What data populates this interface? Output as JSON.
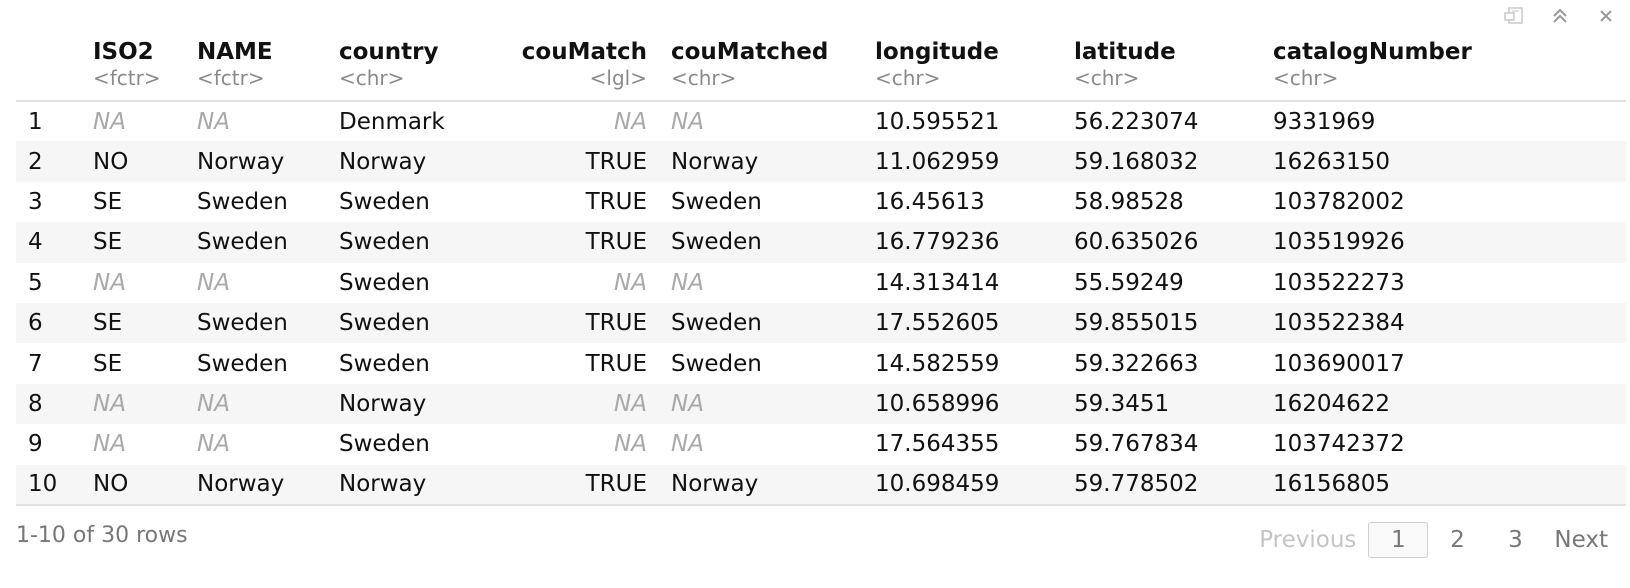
{
  "toolbar": {
    "icons": [
      "export-icon",
      "collapse-icon",
      "close-icon"
    ]
  },
  "columns": [
    {
      "key": "row",
      "name": "",
      "type": ""
    },
    {
      "key": "ISO2",
      "name": "ISO2",
      "type": "<fctr>"
    },
    {
      "key": "NAME",
      "name": "NAME",
      "type": "<fctr>"
    },
    {
      "key": "country",
      "name": "country",
      "type": "<chr>"
    },
    {
      "key": "couMatch",
      "name": "couMatch",
      "type": "<lgl>"
    },
    {
      "key": "couMatched",
      "name": "couMatched",
      "type": "<chr>"
    },
    {
      "key": "longitude",
      "name": "longitude",
      "type": "<chr>"
    },
    {
      "key": "latitude",
      "name": "latitude",
      "type": "<chr>"
    },
    {
      "key": "catalogNumber",
      "name": "catalogNumber",
      "type": "<chr>"
    }
  ],
  "rows": [
    [
      "1",
      "NA",
      "NA",
      "Denmark",
      "NA",
      "NA",
      "10.595521",
      "56.223074",
      "9331969"
    ],
    [
      "2",
      "NO",
      "Norway",
      "Norway",
      "TRUE",
      "Norway",
      "11.062959",
      "59.168032",
      "16263150"
    ],
    [
      "3",
      "SE",
      "Sweden",
      "Sweden",
      "TRUE",
      "Sweden",
      "16.45613",
      "58.98528",
      "103782002"
    ],
    [
      "4",
      "SE",
      "Sweden",
      "Sweden",
      "TRUE",
      "Sweden",
      "16.779236",
      "60.635026",
      "103519926"
    ],
    [
      "5",
      "NA",
      "NA",
      "Sweden",
      "NA",
      "NA",
      "14.313414",
      "55.59249",
      "103522273"
    ],
    [
      "6",
      "SE",
      "Sweden",
      "Sweden",
      "TRUE",
      "Sweden",
      "17.552605",
      "59.855015",
      "103522384"
    ],
    [
      "7",
      "SE",
      "Sweden",
      "Sweden",
      "TRUE",
      "Sweden",
      "14.582559",
      "59.322663",
      "103690017"
    ],
    [
      "8",
      "NA",
      "NA",
      "Norway",
      "NA",
      "NA",
      "10.658996",
      "59.3451",
      "16204622"
    ],
    [
      "9",
      "NA",
      "NA",
      "Sweden",
      "NA",
      "NA",
      "17.564355",
      "59.767834",
      "103742372"
    ],
    [
      "10",
      "NO",
      "Norway",
      "Norway",
      "TRUE",
      "Norway",
      "10.698459",
      "59.778502",
      "16156805"
    ]
  ],
  "footer": {
    "summary": "1-10 of 30 rows",
    "previous_label": "Previous",
    "pages": [
      "1",
      "2",
      "3"
    ],
    "current_page": "1",
    "next_label": "Next"
  }
}
